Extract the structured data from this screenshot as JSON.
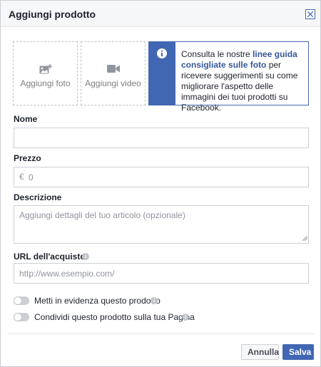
{
  "dialog": {
    "title": "Aggiungi prodotto",
    "close_icon": "close-icon"
  },
  "media": {
    "photo": {
      "label": "Aggiungi foto",
      "icon": "add-photo-icon"
    },
    "video": {
      "label": "Aggiungi video",
      "icon": "video-camera-icon"
    }
  },
  "info": {
    "icon": "info-icon",
    "text_before": "Consulta le nostre ",
    "link": "linee guida consigliate sulle foto",
    "text_after": " per ricevere suggerimenti su come migliorare l'aspetto delle immagini dei tuoi prodotti su Facebook."
  },
  "form": {
    "name": {
      "label": "Nome",
      "value": ""
    },
    "price": {
      "label": "Prezzo",
      "currency": "€",
      "placeholder": "0"
    },
    "description": {
      "label": "Descrizione",
      "placeholder": "Aggiungi dettagli del tuo articolo (opzionale)"
    },
    "url": {
      "label": "URL dell'acquisto",
      "placeholder": "http://www.esempio.com/"
    }
  },
  "toggles": {
    "feature": {
      "label": "Metti in evidenza questo prodotto",
      "on": false
    },
    "share": {
      "label": "Condividi questo prodotto sulla tua Pagina",
      "on": false
    }
  },
  "footer": {
    "cancel_label": "Annulla",
    "save_label": "Salva"
  },
  "colors": {
    "accent": "#4267b2",
    "link": "#365899",
    "border": "#ccd0d5"
  }
}
